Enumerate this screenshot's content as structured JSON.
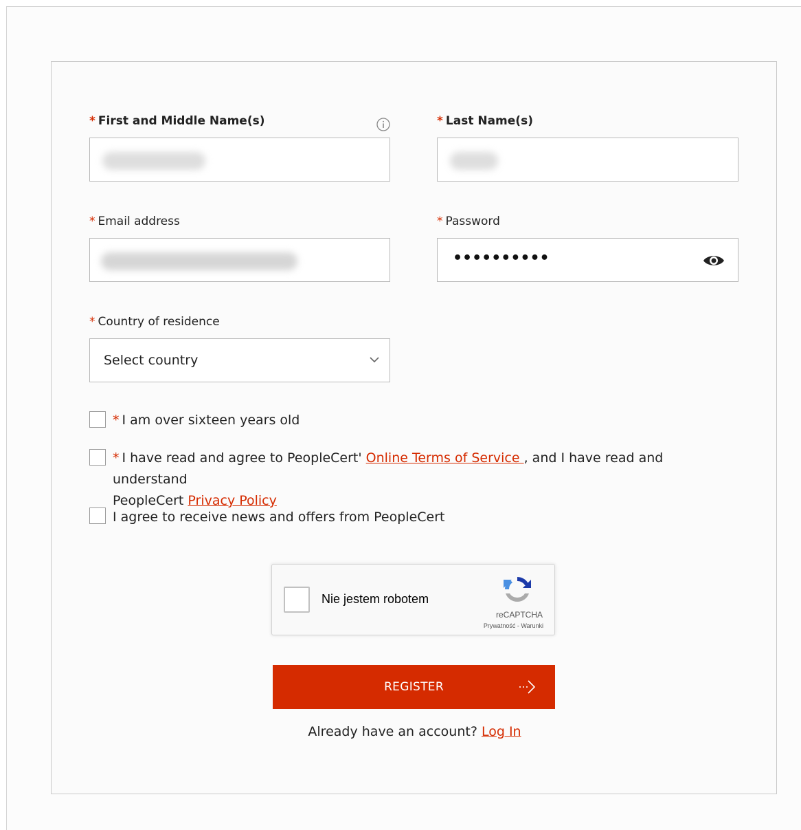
{
  "form": {
    "first_name": {
      "required_mark": "*",
      "label": "First and Middle Name(s)",
      "info_icon": "info-circle-icon"
    },
    "last_name": {
      "required_mark": "*",
      "label": "Last Name(s)"
    },
    "email": {
      "required_mark": "*",
      "label": "Email address"
    },
    "password": {
      "required_mark": "*",
      "label": "Password",
      "masked_value": "••••••••••",
      "toggle_icon": "eye-icon"
    },
    "country": {
      "required_mark": "*",
      "label": "Country of residence",
      "selected": "Select country",
      "icon": "chevron-down-icon"
    },
    "checkboxes": [
      {
        "required_mark": "*",
        "text": "I am over sixteen years old",
        "checked": false
      },
      {
        "required_mark": "*",
        "text_before": "I have read and agree to PeopleCert' ",
        "link1": "Online Terms of Service ",
        "text_middle": ", and I have read and understand",
        "text_line2": "PeopleCert ",
        "link2": "Privacy Policy",
        "checked": false
      },
      {
        "required_mark": "",
        "text": "I agree to receive news and offers from PeopleCert",
        "checked": false
      }
    ]
  },
  "recaptcha": {
    "label": "Nie jestem robotem",
    "brand": "reCAPTCHA",
    "links": "Prywatność - Warunki"
  },
  "register": {
    "label": "REGISTER",
    "icon": "arrow-right-icon"
  },
  "footer": {
    "text": "Already have an account? ",
    "link": "Log In"
  },
  "colors": {
    "accent": "#d52b00",
    "border": "#b9b9b9",
    "background": "#fbfbfb"
  }
}
